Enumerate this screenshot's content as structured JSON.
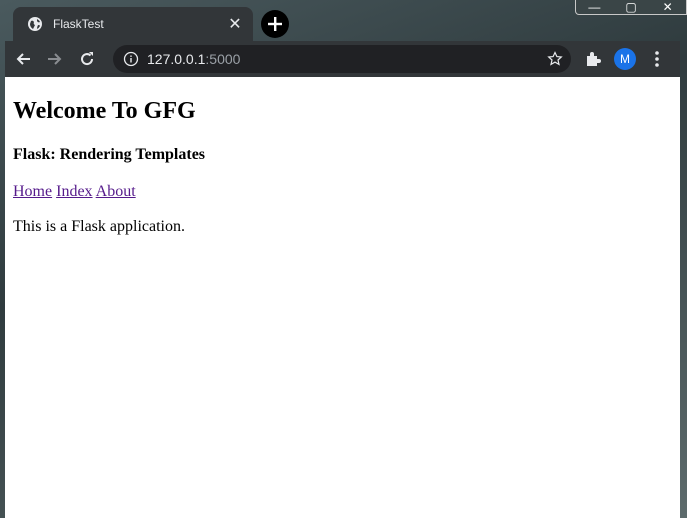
{
  "browser": {
    "window_controls": {
      "minimize": "—",
      "maximize": "▢",
      "close": "✕"
    },
    "tab": {
      "title": "FlaskTest",
      "close": "✕"
    },
    "new_tab_icon": "plus-icon",
    "address": {
      "host": "127.0.0.1",
      "port": ":5000"
    },
    "avatar_letter": "M"
  },
  "page": {
    "heading": "Welcome To GFG",
    "subheading": "Flask: Rendering Templates",
    "nav": [
      {
        "label": "Home"
      },
      {
        "label": "Index"
      },
      {
        "label": "About"
      }
    ],
    "paragraph": "This is a Flask application."
  },
  "colors": {
    "link_visited": "#551a8b",
    "chrome_dark": "#323639",
    "avatar_blue": "#1a73e8"
  }
}
